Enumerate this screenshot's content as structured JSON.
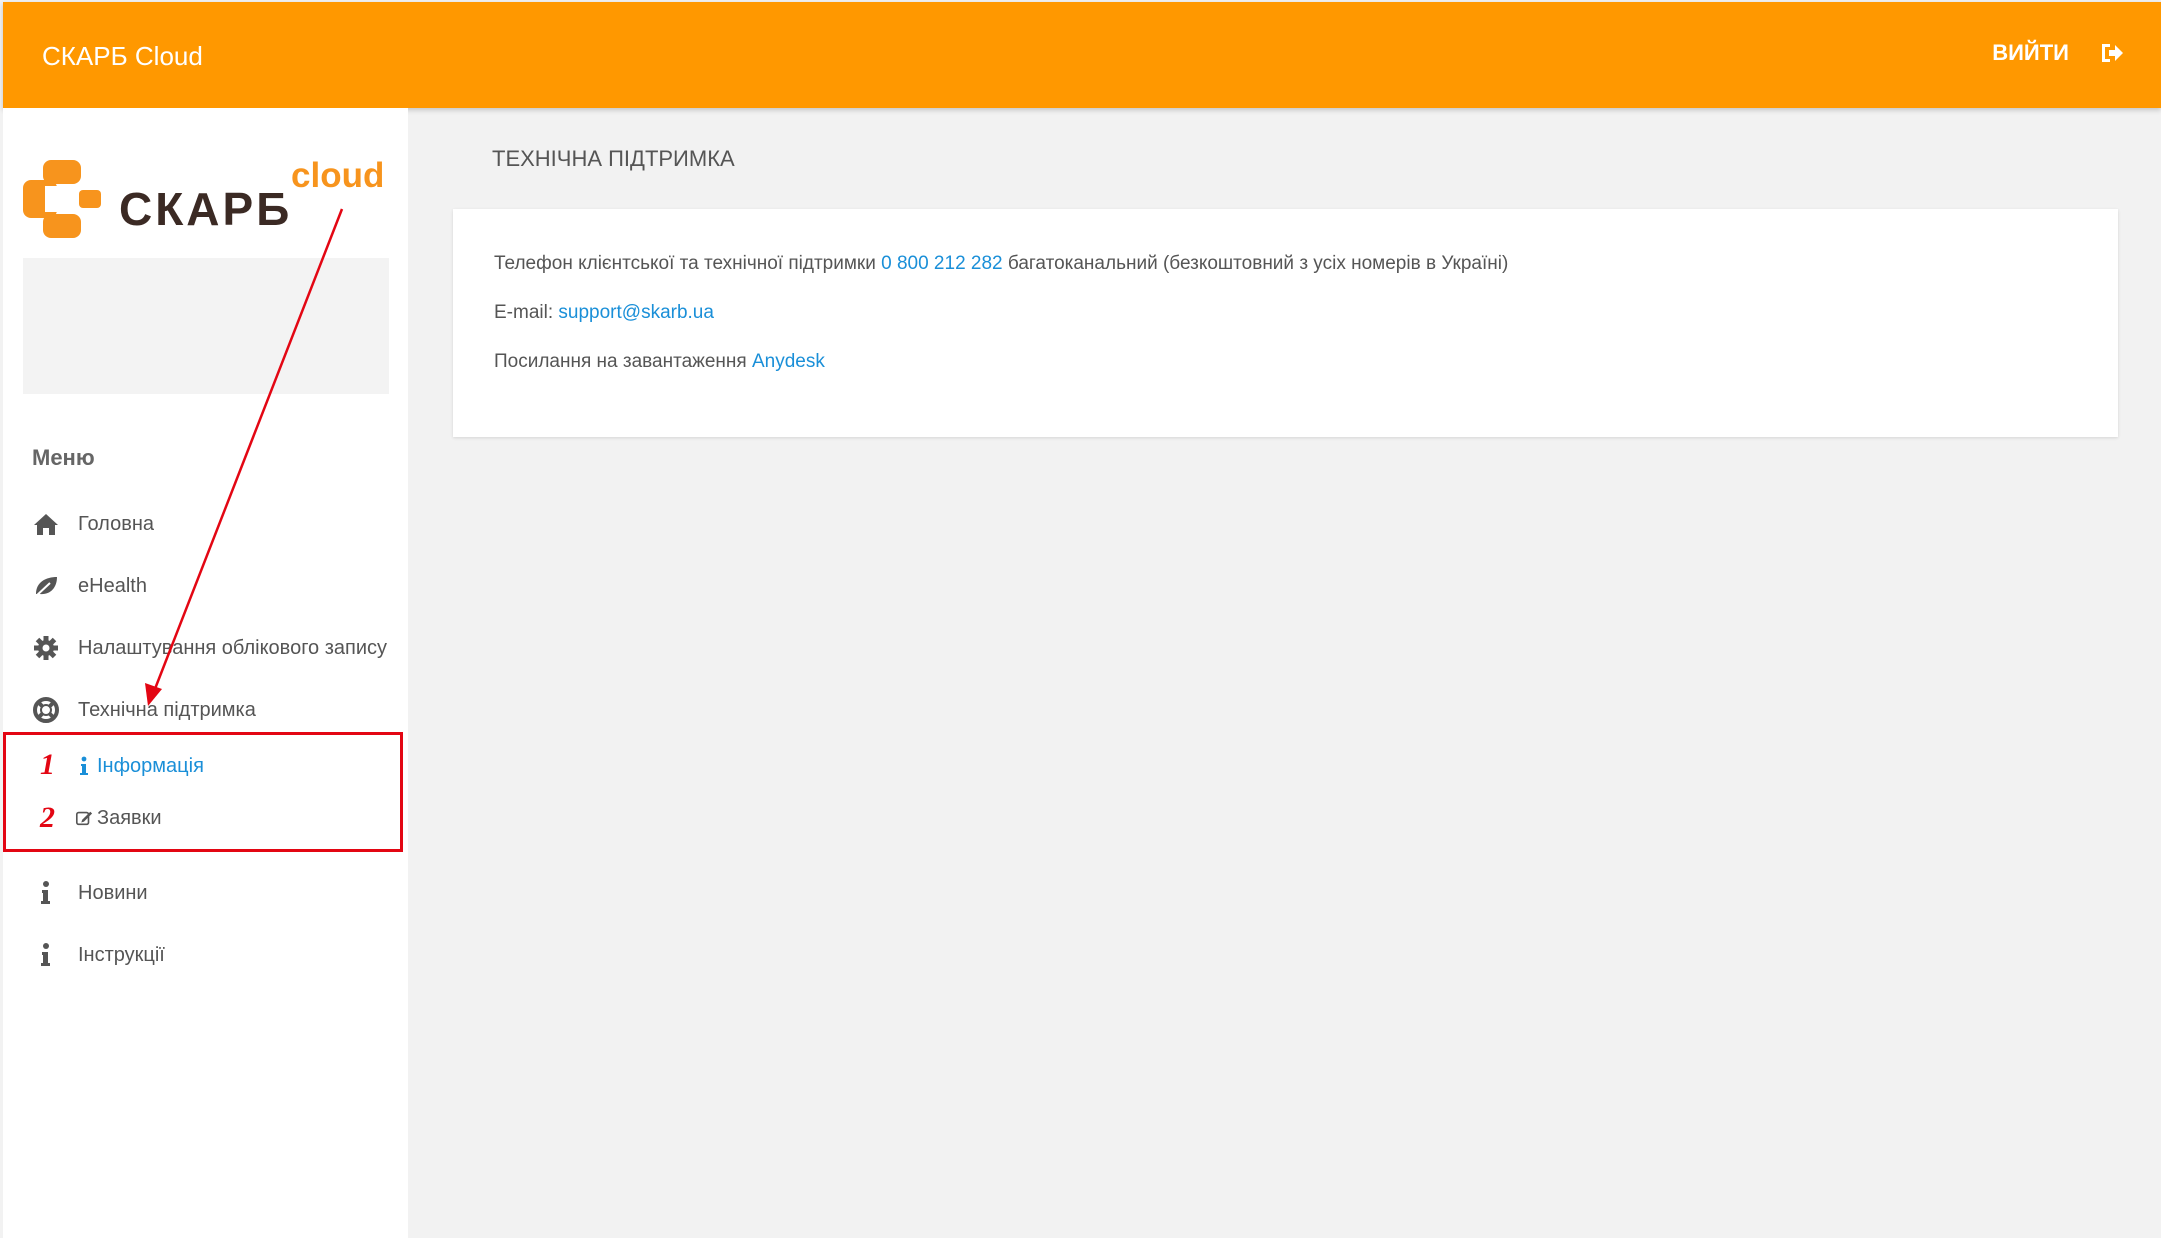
{
  "header": {
    "app_title": "СКАРБ Cloud",
    "logout_label": "ВИЙТИ",
    "logout_icon": "sign-out-icon",
    "background_color": "#ff9800"
  },
  "sidebar": {
    "logo_text": "СКАРБ",
    "logo_sup": "cloud",
    "menu_title": "Меню",
    "items": [
      {
        "label": "Головна",
        "icon": "home-icon"
      },
      {
        "label": "eHealth",
        "icon": "leaf-icon"
      },
      {
        "label": "Налаштування облікового запису",
        "icon": "gear-icon"
      },
      {
        "label": "Технічна підтримка",
        "icon": "lifebuoy-icon"
      },
      {
        "label": "Новини",
        "icon": "info-icon"
      },
      {
        "label": "Інструкції",
        "icon": "info-icon"
      }
    ],
    "subitems": [
      {
        "label": "Інформація",
        "icon": "info-icon",
        "active": true
      },
      {
        "label": "Заявки",
        "icon": "edit-icon",
        "active": false
      }
    ]
  },
  "annotations": {
    "num1": "1",
    "num2": "2",
    "color": "#e30613"
  },
  "main": {
    "page_title": "ТЕХНІЧНА ПІДТРИМКА",
    "phone_prefix": "Телефон клієнтської та технічної підтримки",
    "phone_number": "0 800 212 282",
    "phone_suffix": "багатоканальний (безкоштовний з усіх номерів в Україні)",
    "email_prefix": "E-mail:",
    "email": "support@skarb.ua",
    "download_prefix": "Посилання на завантаження",
    "download_link": "Anydesk",
    "link_color": "#1a8fd8"
  }
}
